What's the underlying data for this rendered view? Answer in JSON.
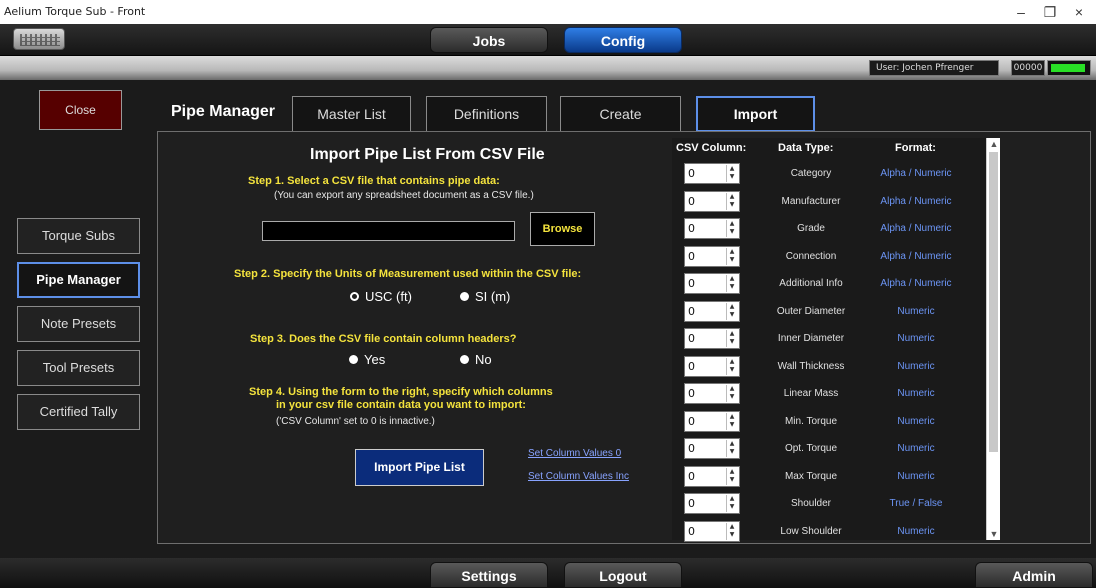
{
  "window": {
    "title": "Aelium Torque Sub - Front",
    "min": "–",
    "max": "❐",
    "close": "×"
  },
  "topnav": {
    "jobs": "Jobs",
    "config": "Config"
  },
  "status": {
    "user": "User: Jochen Pfrenger",
    "code": "00000",
    "battery_level": 0.95
  },
  "sidebar": {
    "close": "Close",
    "items": [
      "Torque Subs",
      "Pipe Manager",
      "Note Presets",
      "Tool Presets",
      "Certified Tally"
    ]
  },
  "section": {
    "title": "Pipe Manager"
  },
  "tabs": [
    "Master List",
    "Definitions",
    "Create",
    "Import"
  ],
  "import": {
    "heading": "Import Pipe List From CSV File",
    "step1": "Step 1. Select a CSV file that contains pipe data:",
    "step1_note": "(You can export any spreadsheet document as a CSV file.)",
    "path_value": "",
    "browse": "Browse",
    "step2": "Step 2. Specify the Units of Measurement used within the CSV file:",
    "unit_usc": "USC (ft)",
    "unit_si": "SI (m)",
    "step3": "Step 3. Does the CSV file contain column headers?",
    "yes": "Yes",
    "no": "No",
    "step4_line1": "Step 4. Using the form to the right, specify which columns",
    "step4_line2": "in your csv file contain data you want to import:",
    "step4_note": "('CSV Column' set to 0 is innactive.)",
    "import_button": "Import Pipe List",
    "set_zero": "Set Column Values 0",
    "set_inc": "Set Column Values Inc"
  },
  "grid": {
    "headers": {
      "csv": "CSV Column:",
      "type": "Data Type:",
      "format": "Format:"
    },
    "rows": [
      {
        "value": "0",
        "type": "Category",
        "format": "Alpha / Numeric"
      },
      {
        "value": "0",
        "type": "Manufacturer",
        "format": "Alpha / Numeric"
      },
      {
        "value": "0",
        "type": "Grade",
        "format": "Alpha / Numeric"
      },
      {
        "value": "0",
        "type": "Connection",
        "format": "Alpha / Numeric"
      },
      {
        "value": "0",
        "type": "Additional Info",
        "format": "Alpha / Numeric"
      },
      {
        "value": "0",
        "type": "Outer Diameter",
        "format": "Numeric"
      },
      {
        "value": "0",
        "type": "Inner Diameter",
        "format": "Numeric"
      },
      {
        "value": "0",
        "type": "Wall Thickness",
        "format": "Numeric"
      },
      {
        "value": "0",
        "type": "Linear Mass",
        "format": "Numeric"
      },
      {
        "value": "0",
        "type": "Min. Torque",
        "format": "Numeric"
      },
      {
        "value": "0",
        "type": "Opt. Torque",
        "format": "Numeric"
      },
      {
        "value": "0",
        "type": "Max Torque",
        "format": "Numeric"
      },
      {
        "value": "0",
        "type": "Shoulder",
        "format": "True / False"
      },
      {
        "value": "0",
        "type": "Low Shoulder",
        "format": "Numeric"
      }
    ]
  },
  "bottom": {
    "settings": "Settings",
    "logout": "Logout",
    "admin": "Admin"
  },
  "colors": {
    "accent_blue": "#5d8fe8",
    "step_yellow": "#f4e33d",
    "format_blue": "#6c95f5",
    "close_red": "#560000"
  }
}
